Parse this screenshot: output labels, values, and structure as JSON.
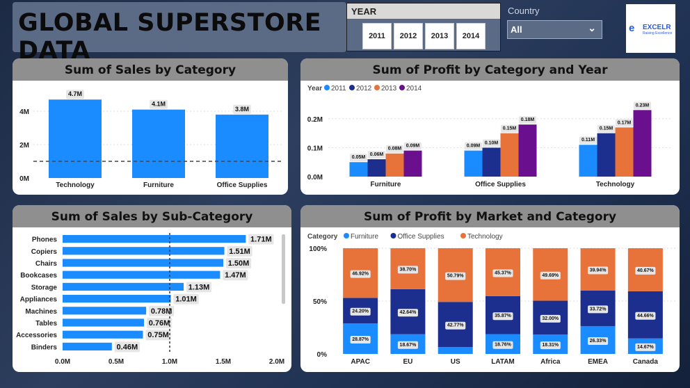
{
  "header": {
    "title": "GLOBAL SUPERSTORE DATA"
  },
  "year_filter": {
    "label": "YEAR",
    "options": [
      "2011",
      "2012",
      "2013",
      "2014"
    ]
  },
  "country_filter": {
    "label": "Country",
    "value": "All"
  },
  "logo": {
    "name": "EXCELR",
    "tagline": "Raising Excellence"
  },
  "colors": {
    "2011": "#1a8cff",
    "2012": "#1c2f8f",
    "2013": "#e8733a",
    "2014": "#6a0f8e",
    "furniture": "#1a8cff",
    "office": "#1c2f8f",
    "technology": "#e8733a"
  },
  "panels": {
    "sales_by_category": "Sum of Sales by Category",
    "profit_by_cat_year": "Sum of Profit by Category and Year",
    "sales_by_subcat": "Sum of Sales by Sub-Category",
    "profit_by_market": "Sum of Profit by Market and Category"
  },
  "chart_data": [
    {
      "type": "bar",
      "title": "Sum of Sales by Category",
      "categories": [
        "Technology",
        "Furniture",
        "Office Supplies"
      ],
      "values": [
        4.7,
        4.1,
        3.8
      ],
      "data_labels": [
        "4.7M",
        "4.1M",
        "3.8M"
      ],
      "yticks": [
        "0M",
        "2M",
        "4M"
      ],
      "ylim": [
        0,
        5
      ],
      "reference_line": 1.0
    },
    {
      "type": "bar",
      "title": "Sum of Profit by Category and Year",
      "legend_title": "Year",
      "categories": [
        "Furniture",
        "Office Supplies",
        "Technology"
      ],
      "series": [
        {
          "name": "2011",
          "values": [
            0.05,
            0.09,
            0.11
          ],
          "labels": [
            "0.05M",
            "0.09M",
            "0.11M"
          ]
        },
        {
          "name": "2012",
          "values": [
            0.06,
            0.1,
            0.15
          ],
          "labels": [
            "0.06M",
            "0.10M",
            "0.15M"
          ]
        },
        {
          "name": "2013",
          "values": [
            0.08,
            0.15,
            0.17
          ],
          "labels": [
            "0.08M",
            "0.15M",
            "0.17M"
          ]
        },
        {
          "name": "2014",
          "values": [
            0.09,
            0.18,
            0.23
          ],
          "labels": [
            "0.09M",
            "0.18M",
            "0.23M"
          ]
        }
      ],
      "yticks": [
        "0.0M",
        "0.1M",
        "0.2M"
      ],
      "ylim": [
        0,
        0.25
      ]
    },
    {
      "type": "bar",
      "orientation": "horizontal",
      "title": "Sum of Sales by Sub-Category",
      "categories": [
        "Phones",
        "Copiers",
        "Chairs",
        "Bookcases",
        "Storage",
        "Appliances",
        "Machines",
        "Tables",
        "Accessories",
        "Binders"
      ],
      "values": [
        1.71,
        1.51,
        1.5,
        1.47,
        1.13,
        1.01,
        0.78,
        0.76,
        0.75,
        0.46
      ],
      "data_labels": [
        "1.71M",
        "1.51M",
        "1.50M",
        "1.47M",
        "1.13M",
        "1.01M",
        "0.78M",
        "0.76M",
        "0.75M",
        "0.46M"
      ],
      "xticks": [
        "0.0M",
        "0.5M",
        "1.0M",
        "1.5M",
        "2.0M"
      ],
      "xlim": [
        0,
        2.0
      ],
      "reference_line": 1.0
    },
    {
      "type": "bar",
      "stacked": "100%",
      "title": "Sum of Profit by Market and Category",
      "legend_title": "Category",
      "categories": [
        "APAC",
        "EU",
        "US",
        "LATAM",
        "Africa",
        "EMEA",
        "Canada"
      ],
      "series": [
        {
          "name": "Furniture",
          "values": [
            28.87,
            18.67,
            6.44,
            18.76,
            18.31,
            26.33,
            14.67
          ],
          "labels": [
            "28.87%",
            "18.67%",
            "",
            "18.76%",
            "18.31%",
            "26.33%",
            "14.67%"
          ]
        },
        {
          "name": "Office Supplies",
          "values": [
            24.2,
            42.64,
            42.77,
            35.87,
            32.0,
            33.72,
            44.66
          ],
          "labels": [
            "24.20%",
            "42.64%",
            "42.77%",
            "35.87%",
            "32.00%",
            "33.72%",
            "44.66%"
          ]
        },
        {
          "name": "Technology",
          "values": [
            46.92,
            38.7,
            50.79,
            45.37,
            49.69,
            39.94,
            40.67
          ],
          "labels": [
            "46.92%",
            "38.70%",
            "50.79%",
            "45.37%",
            "49.69%",
            "39.94%",
            "40.67%"
          ]
        }
      ],
      "yticks": [
        "0%",
        "50%",
        "100%"
      ],
      "ylim": [
        0,
        100
      ]
    }
  ]
}
